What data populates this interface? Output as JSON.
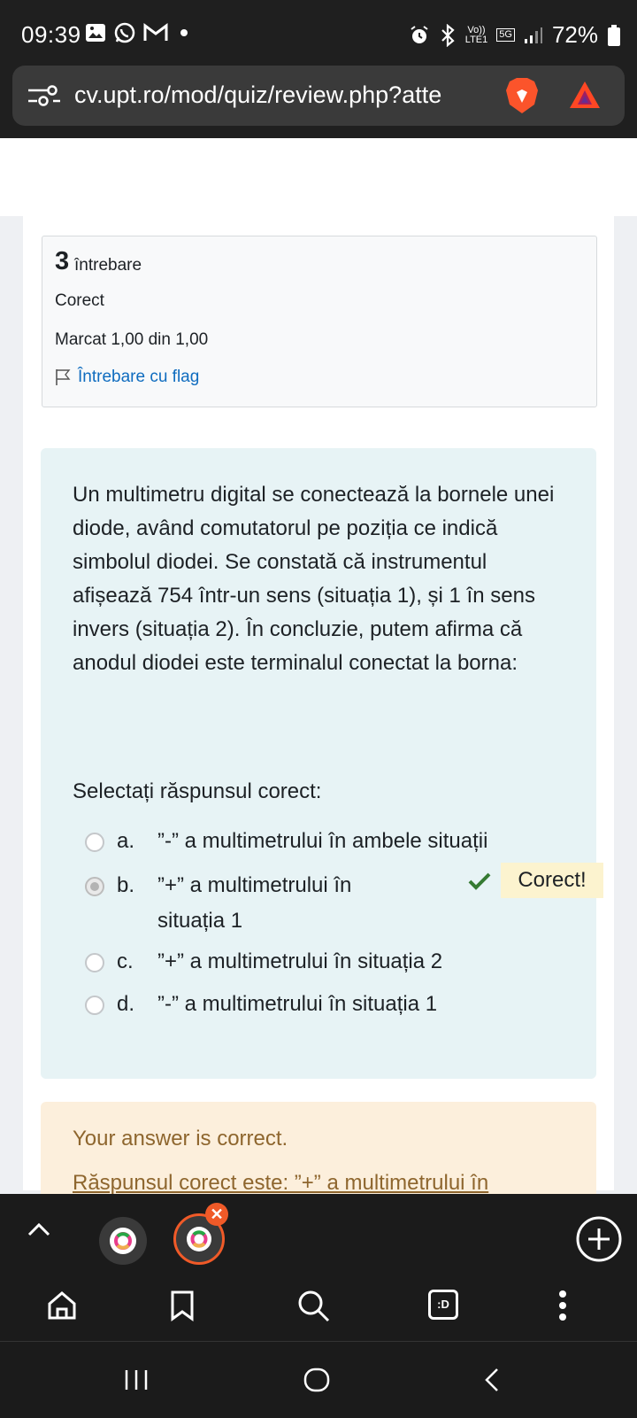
{
  "status_bar": {
    "time": "09:39",
    "battery": "72%",
    "network_top": "Vo))",
    "network_bottom": "LTE1",
    "network_gen": "5G"
  },
  "browser": {
    "url": "cv.upt.ro/mod/quiz/review.php?atte"
  },
  "question_info": {
    "number": "3",
    "word": "întrebare",
    "state": "Corect",
    "grade": "Marcat 1,00 din 1,00",
    "flag_label": "Întrebare cu flag"
  },
  "question": {
    "text": " Un multimetru digital se conectează la bornele unei diode, având comutatorul pe poziția ce indică simbolul diodei. Se constată că instrumentul afișează 754 într-un sens (situația 1), și 1 în sens invers (situația 2). În concluzie, putem afirma că anodul diodei este terminalul conectat la borna:",
    "prompt": "Selectați răspunsul corect:",
    "answers": [
      {
        "letter": "a.",
        "text": "”-” a multimetrului în ambele situații"
      },
      {
        "letter": "b.",
        "text": "”+” a multimetrului în",
        "text2": "situația 1"
      },
      {
        "letter": "c.",
        "text": "”+” a multimetrului în situația 2"
      },
      {
        "letter": "d.",
        "text": "”-” a multimetrului în situația 1"
      }
    ],
    "correct_badge": "Corect!"
  },
  "feedback": {
    "general": "Your answer is correct.",
    "right_answer": "Răspunsul corect este: ”+” a multimetrului în"
  },
  "toolbar": {
    "tab_button_label": ":D"
  },
  "colors": {
    "accent_link": "#0f6cbf",
    "feedback_text": "#8e662e",
    "tab_active": "#f05a28",
    "correct_green": "#357a32"
  }
}
